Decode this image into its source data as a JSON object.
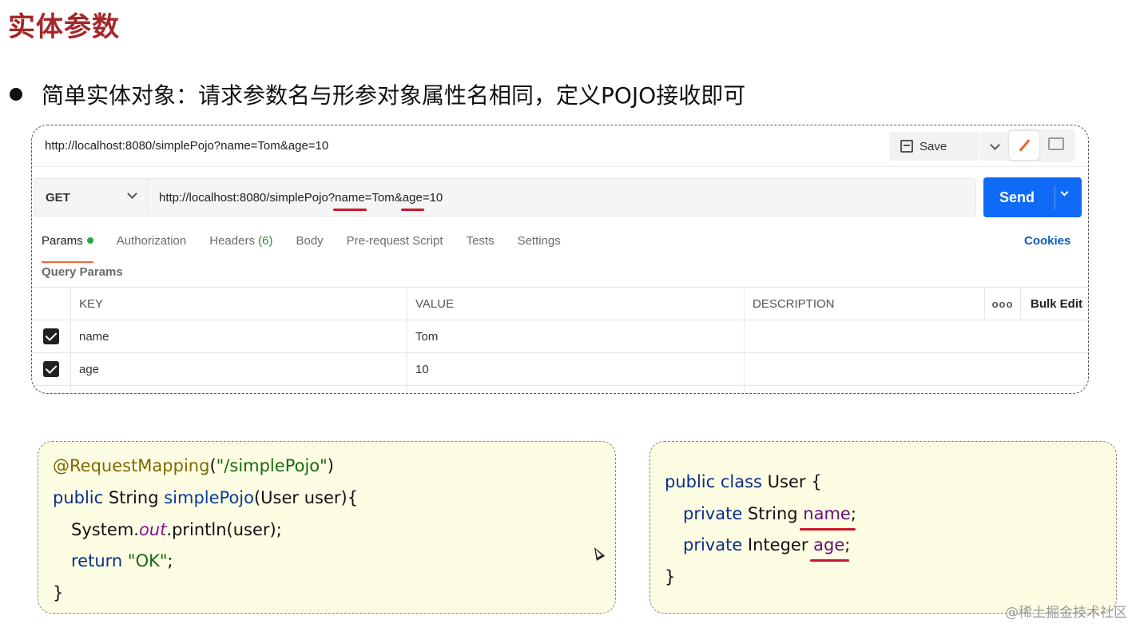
{
  "slide": {
    "title": "实体参数",
    "bullet": "简单实体对象：请求参数名与形参对象属性名相同，定义POJO接收即可",
    "watermark": "@稀土掘金技术社区"
  },
  "postman": {
    "tab_title": "http://localhost:8080/simplePojo?name=Tom&age=10",
    "save_label": "Save",
    "method": "GET",
    "url_parts": [
      "http://localhost:8080/simplePojo?",
      "name",
      "=Tom&",
      "age",
      "=10"
    ],
    "send_label": "Send",
    "tabs": [
      {
        "label": "Params",
        "active": true,
        "indicator": "green-dot"
      },
      {
        "label": "Authorization"
      },
      {
        "label": "Headers",
        "count": "(6)"
      },
      {
        "label": "Body"
      },
      {
        "label": "Pre-request Script"
      },
      {
        "label": "Tests"
      },
      {
        "label": "Settings"
      }
    ],
    "cookies_label": "Cookies",
    "query_params_label": "Query Params",
    "table": {
      "headers": [
        "KEY",
        "VALUE",
        "DESCRIPTION"
      ],
      "more_label": "ooo",
      "bulk_edit_label": "Bulk Edit",
      "rows": [
        {
          "checked": true,
          "key": "name",
          "value": "Tom",
          "description": ""
        },
        {
          "checked": true,
          "key": "age",
          "value": "10",
          "description": ""
        }
      ]
    }
  },
  "code_left": {
    "l1": {
      "annotation": "@RequestMapping",
      "open": "(",
      "str": "\"/simplePojo\"",
      "close": ")"
    },
    "l2": {
      "kw": "public",
      "type": " String ",
      "fn": "simplePojo",
      "rest": "(User user){"
    },
    "l3": {
      "pre": "System.",
      "static": "out",
      "rest": ".println(user);"
    },
    "l4": {
      "kw": "return",
      "sp": " ",
      "str": "\"OK\"",
      "end": ";"
    },
    "l5": {
      "text": "}"
    }
  },
  "code_right": {
    "l1": {
      "kw": "public class",
      "rest": " User {"
    },
    "l2": {
      "kw": "private",
      "type": " String ",
      "field": "name",
      "end": ";"
    },
    "l3": {
      "kw": "private",
      "type": " Integer ",
      "field": "age",
      "end": ";"
    },
    "l4": {
      "text": "}"
    }
  },
  "colors": {
    "title": "#a4282a",
    "send": "#0f6bf5",
    "underline": "#c9162b",
    "code_bg": "#fdfde4"
  },
  "icons": [
    "save-icon",
    "chevron-down-icon",
    "pencil-icon",
    "comment-icon",
    "checkbox-icon",
    "cursor-icon"
  ]
}
